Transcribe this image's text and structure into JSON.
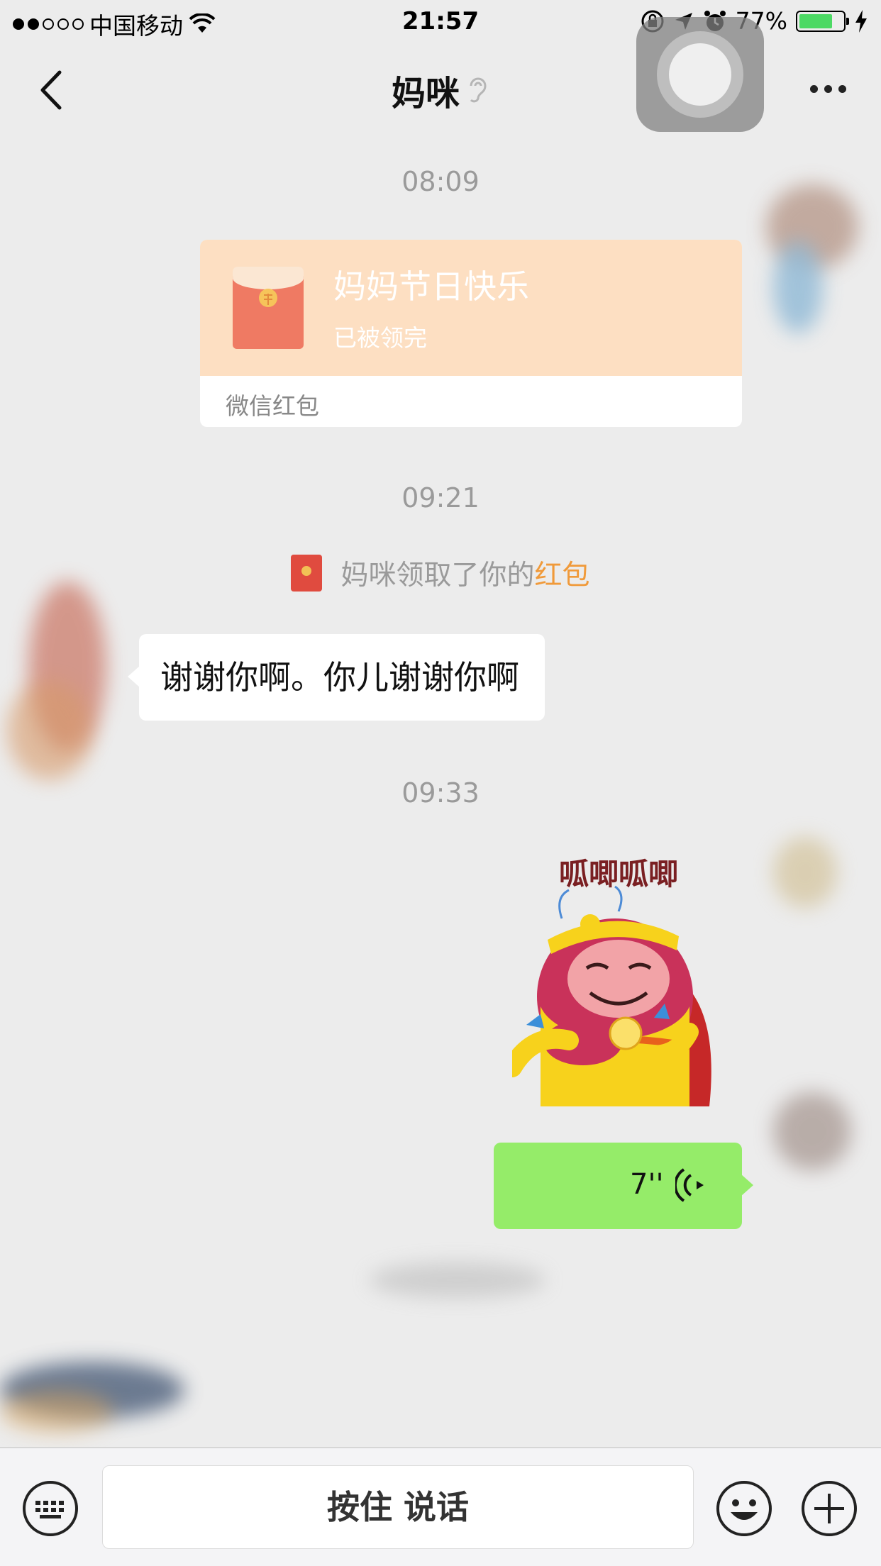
{
  "status_bar": {
    "carrier": "中国移动",
    "time": "21:57",
    "battery_percent": "77%",
    "battery_level": 0.77,
    "icons": [
      "signal-icon",
      "wifi-icon",
      "orientation-lock-icon",
      "location-icon",
      "alarm-icon",
      "battery-icon",
      "charging-icon"
    ]
  },
  "nav": {
    "title": "妈咪",
    "title_icon": "earpiece-icon",
    "back_icon": "chevron-left-icon",
    "more_icon": "more-icon"
  },
  "messages": {
    "time_1": "08:09",
    "red_packet": {
      "title": "妈妈节日快乐",
      "status": "已被领完",
      "footer": "微信红包"
    },
    "time_2": "09:21",
    "notice": {
      "prefix": "妈咪领取了你的",
      "link": "红包"
    },
    "text_message": "谢谢你啊。你儿谢谢你啊",
    "time_3": "09:33",
    "sticker": {
      "caption": "呱唧呱唧"
    },
    "voice": {
      "duration": "7''"
    }
  },
  "input_bar": {
    "hold_to_talk": "按住 说话",
    "icons": [
      "keyboard-icon",
      "emoji-icon",
      "plus-icon"
    ]
  },
  "colors": {
    "background": "#ececec",
    "red_packet": "#fddfc2",
    "voice_bubble": "#95ec69",
    "link": "#f09a3a"
  }
}
